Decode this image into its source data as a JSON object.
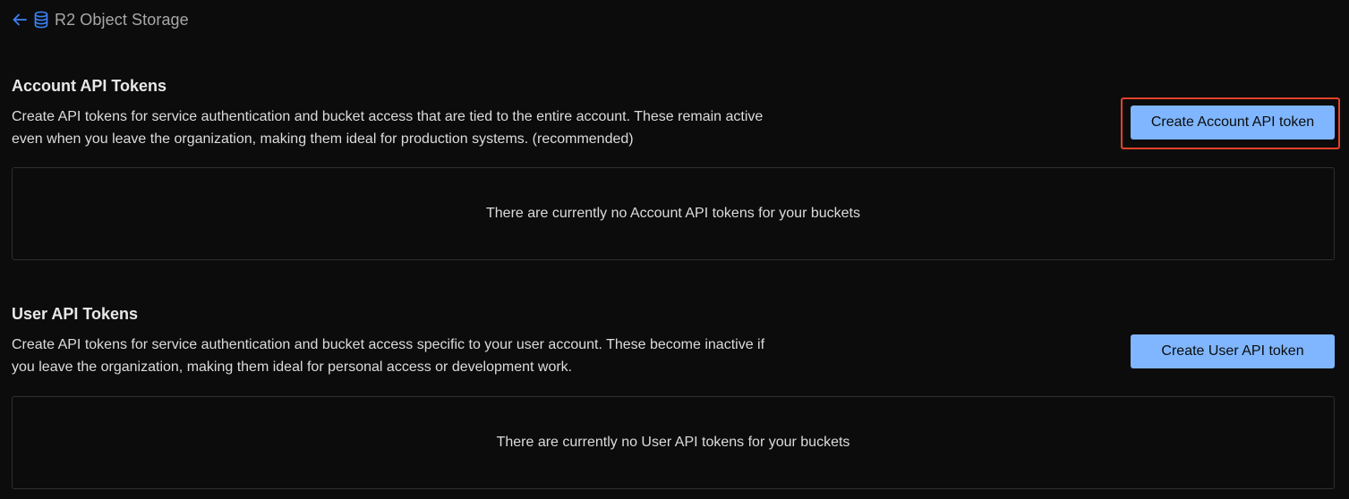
{
  "breadcrumb": {
    "back_icon": "arrow-left-icon",
    "db_icon": "database-icon",
    "label": "R2 Object Storage"
  },
  "account_section": {
    "title": "Account API Tokens",
    "description_line1": "Create API tokens for service authentication and bucket access that are tied to the entire account. These remain active",
    "description_line2": "even when you leave the organization, making them ideal for production systems. (recommended)",
    "button_label": "Create Account API token",
    "empty_message": "There are currently no Account API tokens for your buckets"
  },
  "user_section": {
    "title": "User API Tokens",
    "description_line1": "Create API tokens for service authentication and bucket access specific to your user account. These become inactive if",
    "description_line2": "you leave the organization, making them ideal for personal access or development work.",
    "button_label": "Create User API token",
    "empty_message": "There are currently no User API tokens for your buckets"
  },
  "colors": {
    "background": "#0c0c0c",
    "accent_button": "#7fb6ff",
    "highlight_border": "#e5432b",
    "link_icon": "#3b82f6"
  }
}
